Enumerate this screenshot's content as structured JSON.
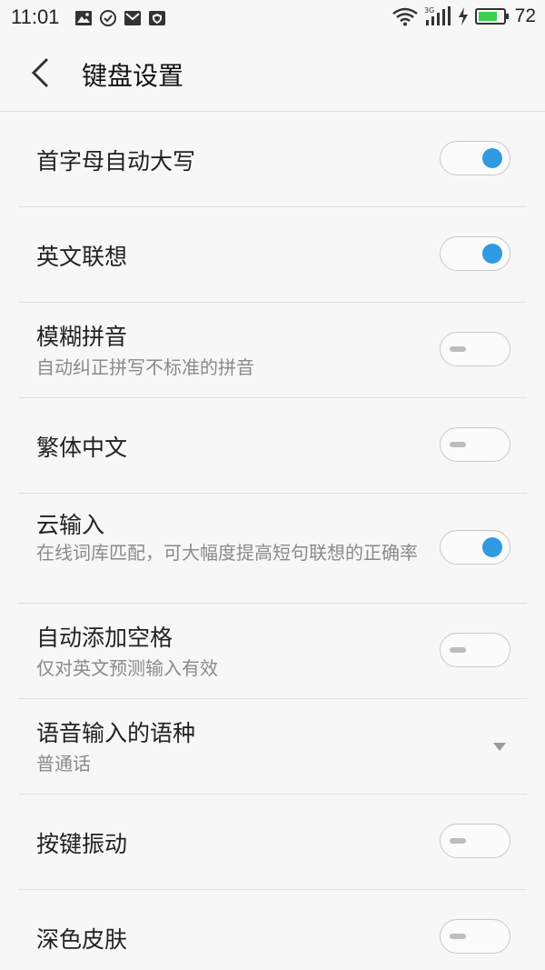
{
  "status_bar": {
    "time": "11:01",
    "battery": "72",
    "network": "3G",
    "left_icons": [
      "image-icon",
      "check-circle-icon",
      "mail-icon",
      "shield-icon"
    ]
  },
  "header": {
    "title": "键盘设置"
  },
  "settings": [
    {
      "title": "首字母自动大写",
      "subtitle": "",
      "control": "toggle",
      "on": true
    },
    {
      "title": "英文联想",
      "subtitle": "",
      "control": "toggle",
      "on": true
    },
    {
      "title": "模糊拼音",
      "subtitle": "自动纠正拼写不标准的拼音",
      "control": "toggle",
      "on": false
    },
    {
      "title": "繁体中文",
      "subtitle": "",
      "control": "toggle",
      "on": false
    },
    {
      "title": "云输入",
      "subtitle": "在线词库匹配，可大幅度提高短句联想的正确率",
      "control": "toggle",
      "on": true
    },
    {
      "title": "自动添加空格",
      "subtitle": "仅对英文预测输入有效",
      "control": "toggle",
      "on": false
    },
    {
      "title": "语音输入的语种",
      "subtitle": "普通话",
      "control": "dropdown",
      "on": false
    },
    {
      "title": "按键振动",
      "subtitle": "",
      "control": "toggle",
      "on": false
    },
    {
      "title": "深色皮肤",
      "subtitle": "",
      "control": "toggle",
      "on": false
    }
  ],
  "colors": {
    "accent": "#2f9ae0",
    "background": "#f7f7f7",
    "battery": "#3ccf4e"
  }
}
